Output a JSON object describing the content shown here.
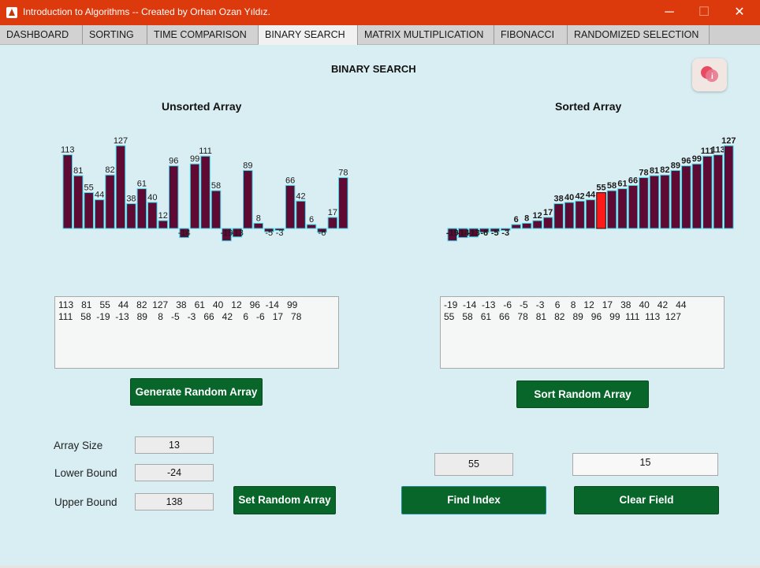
{
  "window": {
    "title": "Introduction to Algorithms -- Created by Orhan Ozan Yıldız.",
    "minimize": "─",
    "maximize": "☐",
    "close": "✕"
  },
  "tabs": [
    "DASHBOARD",
    "SORTING",
    "TIME COMPARISON",
    "BINARY SEARCH",
    "MATRIX MULTIPLICATION",
    "FIBONACCI",
    "RANDOMIZED SELECTION"
  ],
  "active_tab": "BINARY SEARCH",
  "page_title": "BINARY SEARCH",
  "colors": {
    "bar_fill": "#5e0a32",
    "bar_edge": "#38d8ec",
    "highlight": "#ff1a1a",
    "button": "#08662a",
    "titlebar": "#dc3a0c",
    "background": "#d8eef2"
  },
  "icons": {
    "help": "info-bubble-icon",
    "app": "matlab-icon"
  },
  "unsorted": {
    "title": "Unsorted Array",
    "textarea_lines": [
      "113   81   55   44   82  127   38   61   40   12   96  -14   99",
      "111   58  -19  -13   89    8   -5   -3   66   42    6   -6   17   78"
    ],
    "generate_label": "Generate Random Array"
  },
  "sorted": {
    "title": "Sorted Array",
    "textarea_lines": [
      "-19  -14  -13   -6   -5   -3    6    8   12   17   38   40   42   44",
      "55   58   61   66   78   81   82   89   96   99  111  113  127"
    ],
    "sort_label": "Sort Random Array"
  },
  "settings": {
    "array_size_label": "Array Size",
    "array_size": "13",
    "lower_bound_label": "Lower Bound",
    "lower_bound": "-24",
    "upper_bound_label": "Upper Bound",
    "upper_bound": "138",
    "set_label": "Set Random Array"
  },
  "search": {
    "target": "55",
    "result": "15",
    "find_label": "Find Index",
    "clear_label": "Clear Field"
  },
  "chart_data": [
    {
      "type": "bar",
      "title": "Unsorted Array",
      "values": [
        113,
        81,
        55,
        44,
        82,
        127,
        38,
        61,
        40,
        12,
        96,
        -14,
        99,
        111,
        58,
        -19,
        -13,
        89,
        8,
        -5,
        -3,
        66,
        42,
        6,
        -6,
        17,
        78
      ],
      "labels": [
        "113",
        "81",
        "55",
        "44",
        "82",
        "127",
        "38",
        "61",
        "40",
        "12",
        "96",
        "-14",
        "99",
        "111",
        "58",
        "-19",
        "-13",
        "89",
        "8",
        "-5",
        "-3",
        "66",
        "42",
        "6",
        "-6",
        "17",
        "78"
      ],
      "ylim": [
        -19,
        127
      ]
    },
    {
      "type": "bar",
      "title": "Sorted Array",
      "highlight_index": 14,
      "values": [
        -19,
        -14,
        -13,
        -6,
        -5,
        -3,
        6,
        8,
        12,
        17,
        38,
        40,
        42,
        44,
        55,
        58,
        61,
        66,
        78,
        81,
        82,
        89,
        96,
        99,
        111,
        113,
        127
      ],
      "labels": [
        "-19",
        "-14",
        "-13",
        "-6",
        "-5",
        "-3",
        "6",
        "8",
        "12",
        "17",
        "38",
        "40",
        "42",
        "44",
        "55",
        "58",
        "61",
        "66",
        "78",
        "81",
        "82",
        "89",
        "96",
        "99",
        "111",
        "113",
        "127"
      ],
      "ylim": [
        -19,
        127
      ]
    }
  ]
}
